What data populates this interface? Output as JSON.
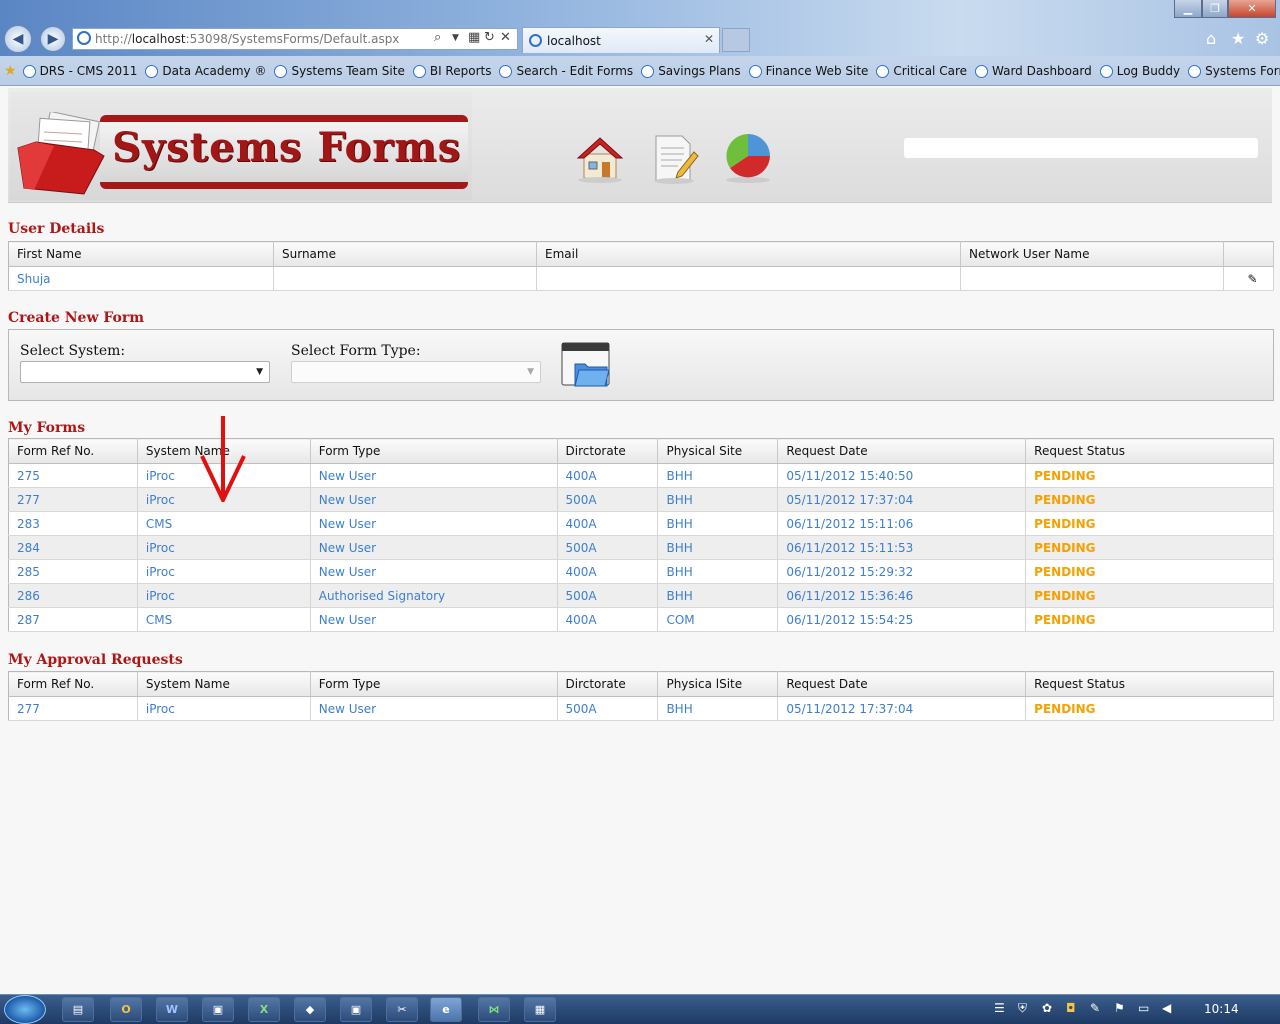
{
  "browser": {
    "address_prefix": "http://",
    "address_host": "localhost",
    "address_rest": ":53098/SystemsForms/Default.aspx",
    "tab_title": "localhost",
    "favorites": [
      "DRS - CMS 2011",
      "Data Academy ®",
      "Systems Team Site",
      "BI Reports",
      "Search - Edit Forms",
      "Savings Plans",
      "Finance Web Site",
      "Critical Care",
      "Ward Dashboard",
      "Log Buddy",
      "Systems Forms"
    ]
  },
  "header": {
    "logo_text": "Systems Forms"
  },
  "user_details": {
    "title": "User Details",
    "columns": [
      "First Name",
      "Surname",
      "Email",
      "Network User Name"
    ],
    "row": {
      "first_name": "Shuja",
      "surname": "",
      "email": "",
      "network_user_name": ""
    }
  },
  "create_form": {
    "title": "Create New Form",
    "system_label": "Select System:",
    "form_type_label": "Select Form Type:"
  },
  "my_forms": {
    "title": "My Forms",
    "columns": [
      "Form Ref No.",
      "System Name",
      "Form Type",
      "Dirctorate",
      "Physical Site",
      "Request Date",
      "Request Status"
    ],
    "rows": [
      [
        "275",
        "iProc",
        "New User",
        "400A",
        "BHH",
        "05/11/2012 15:40:50",
        "PENDING"
      ],
      [
        "277",
        "iProc",
        "New User",
        "500A",
        "BHH",
        "05/11/2012 17:37:04",
        "PENDING"
      ],
      [
        "283",
        "CMS",
        "New User",
        "400A",
        "BHH",
        "06/11/2012 15:11:06",
        "PENDING"
      ],
      [
        "284",
        "iProc",
        "New User",
        "500A",
        "BHH",
        "06/11/2012 15:11:53",
        "PENDING"
      ],
      [
        "285",
        "iProc",
        "New User",
        "400A",
        "BHH",
        "06/11/2012 15:29:32",
        "PENDING"
      ],
      [
        "286",
        "iProc",
        "Authorised Signatory",
        "500A",
        "BHH",
        "06/11/2012 15:36:46",
        "PENDING"
      ],
      [
        "287",
        "CMS",
        "New User",
        "400A",
        "COM",
        "06/11/2012 15:54:25",
        "PENDING"
      ]
    ]
  },
  "approvals": {
    "title": "My Approval Requests",
    "columns": [
      "Form Ref No.",
      "System Name",
      "Form Type",
      "Dirctorate",
      "Physica lSite",
      "Request Date",
      "Request Status"
    ],
    "rows": [
      [
        "277",
        "iProc",
        "New User",
        "500A",
        "BHH",
        "05/11/2012 17:37:04",
        "PENDING"
      ]
    ]
  },
  "taskbar": {
    "clock": "10:14"
  },
  "colors": {
    "link": "#3d7fcf",
    "status": "#f5a200",
    "title": "#b01515"
  }
}
